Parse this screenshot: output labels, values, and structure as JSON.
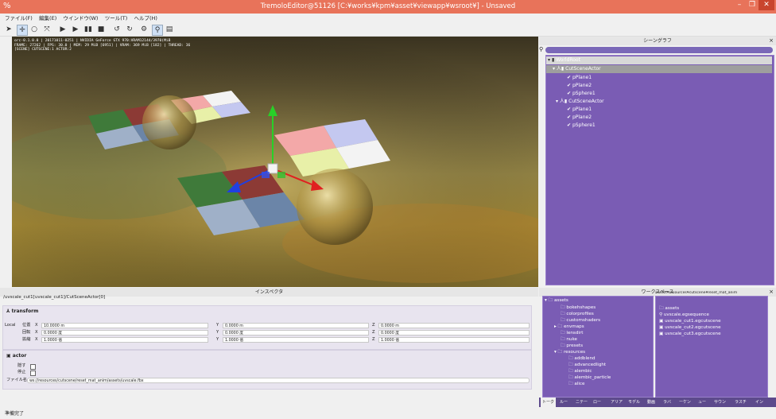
{
  "window": {
    "title": "TremoloEditor@51126 [C:¥works¥kpm¥asset¥viewapp¥wsroot¥] - Unsaved",
    "app_icon": "%",
    "minimize": "–",
    "maximize": "❐",
    "close": "✕"
  },
  "menu": [
    "ファイル(F)",
    "編集(E)",
    "ウインドウ(W)",
    "ツール(T)",
    "ヘルプ(H)"
  ],
  "toolbar_icons": [
    "pointer-icon",
    "move-icon",
    "rotate-icon",
    "scale-icon",
    "play-icon",
    "step-icon",
    "pause-icon",
    "stop-icon",
    "undo-icon",
    "redo-icon",
    "gear-icon",
    "person-icon",
    "layout-icon"
  ],
  "viewport": {
    "info_line1": "orc-0.1.0.0 | 20171011-0251 | NVIDIA GeForce GTX 970:VRAM12144/3970(MiB",
    "info_line2": "FRAME: 27262 | FPS: 30.0 | MEM: 29 MiB [6951] | VRAM: 369 MiB [182] | THREAD: 36",
    "info_line3": "[SCENE] CUTSCENE:1 ACTOR:2"
  },
  "scenegraph": {
    "header": "シーングラフ",
    "close": "×",
    "root": "WorldRoot",
    "actor1": "CutSceneActor",
    "actor1_children": [
      "pPlane1",
      "pPlane2",
      "pSphere1"
    ],
    "actor2": "CutSceneActor",
    "actor2_children": [
      "pPlane1",
      "pPlane2",
      "pSphere1"
    ]
  },
  "inspector": {
    "header": "インスペクタ",
    "path": "/uvscale_cut1[uvscale_cut1]/CutSceneActor[0]",
    "transform_title": "transform",
    "local_label": "Local",
    "rows": [
      {
        "label": "位置",
        "x": "10.0000 m",
        "y": "0.0000 m",
        "z": "0.0000 m"
      },
      {
        "label": "回転",
        "x": "0.0000 度",
        "y": "0.0000 度",
        "z": "0.0000 度"
      },
      {
        "label": "拡縮",
        "x": "1.0000 倍",
        "y": "1.0000 倍",
        "z": "1.0000 倍"
      }
    ],
    "axis_x": "X",
    "axis_y": "Y",
    "axis_z": "Z",
    "actor_title": "actor",
    "hide_label": "隠す",
    "stop_label": "停止",
    "file_label": "ファイル名",
    "file_value": "ws://resources/cutscene/reset_mat_anim/assets/uvscale.fbx"
  },
  "workspace": {
    "header": "ワークスペース",
    "close": "×",
    "right_path": "assets¥resources¥cutscene¥reset_mat_anim",
    "tree": [
      {
        "name": "assets",
        "level": 0
      },
      {
        "name": "bokehshapes",
        "level": 1
      },
      {
        "name": "colorprofiles",
        "level": 1
      },
      {
        "name": "customshaders",
        "level": 1
      },
      {
        "name": "envmaps",
        "level": 1
      },
      {
        "name": "lensdirt",
        "level": 1
      },
      {
        "name": "nuke",
        "level": 1
      },
      {
        "name": "presets",
        "level": 1
      },
      {
        "name": "resources",
        "level": 1
      },
      {
        "name": "addblend",
        "level": 2
      },
      {
        "name": "advancedlight",
        "level": 2
      },
      {
        "name": "alembic",
        "level": 2
      },
      {
        "name": "alembic_particle",
        "level": 2
      },
      {
        "name": "alice",
        "level": 2
      }
    ],
    "files": [
      "assets",
      "uvscale.egsequence",
      "uvscale_cut1.egcutscene",
      "uvscale_cut2.egcutscene",
      "uvscale_cut3.egcutscene"
    ],
    "tabs": [
      "トーク",
      "ルー",
      "ニテー",
      "ロー",
      "アリア",
      "モデル",
      "動画",
      "ラバ",
      "ーケン",
      "ュー",
      "サウン",
      "ラスチ",
      "イン"
    ]
  },
  "status": "準備完了"
}
